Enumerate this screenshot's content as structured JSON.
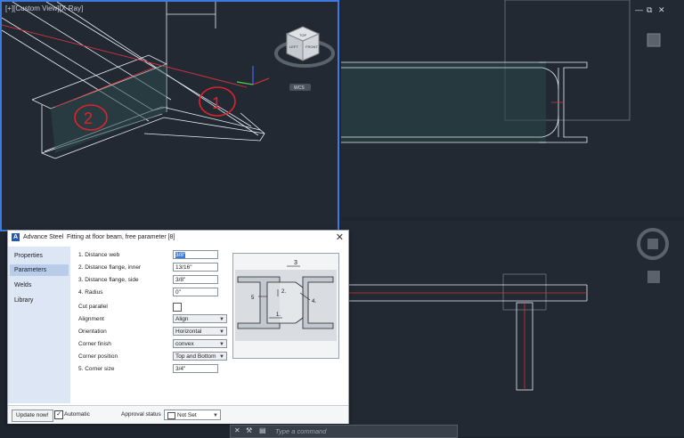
{
  "viewports": {
    "top_left_label": "[+][Custom View][X-Ray]",
    "top_left_elevation": "WCS"
  },
  "window_controls": {
    "minimize": "—",
    "restore": "⧉",
    "close": "✕"
  },
  "viewcube": {
    "top_face": "TOP",
    "left_face": "LEFT",
    "front_face": "FRONT"
  },
  "annotations": {
    "circled_one": "1",
    "circled_two": "2"
  },
  "dialog": {
    "app_name": "Advance Steel",
    "title": "Fitting at floor beam, free parameter [8]",
    "close_glyph": "✕",
    "sidebar": [
      {
        "label": "Properties"
      },
      {
        "label": "Parameters"
      },
      {
        "label": "Welds"
      },
      {
        "label": "Library"
      }
    ],
    "fields": {
      "distance_web": {
        "label": "1. Distance web",
        "value": "3/8\""
      },
      "distance_flange_inner": {
        "label": "2. Distance flange, inner",
        "value": "13/16\""
      },
      "distance_flange_side": {
        "label": "3. Distance flange, side",
        "value": "3/8\""
      },
      "radius": {
        "label": "4. Radius",
        "value": "0\""
      },
      "cut_parallel": {
        "label": "Cut parallel",
        "checked": false
      },
      "alignment": {
        "label": "Alignment",
        "value": "Align"
      },
      "orientation": {
        "label": "Orientation",
        "value": "Horizontal"
      },
      "corner_finish": {
        "label": "Corner finish",
        "value": "convex"
      },
      "corner_position": {
        "label": "Corner position",
        "value": "Top and Bottom"
      },
      "corner_size": {
        "label": "5. Corner size",
        "value": "3/4\""
      }
    },
    "preview_labels": {
      "d1": "1.",
      "d2": "2.",
      "d3": "3",
      "d4": "4.",
      "d5": "5"
    },
    "footer": {
      "update_button": "Update now!",
      "automatic_label": "Automatic",
      "automatic_checked": true,
      "approval_label": "Approval status",
      "approval_value": "Not Set"
    }
  },
  "command_line": {
    "placeholder": "Type a command"
  },
  "colors": {
    "viewport_bg": "#222933",
    "active_border": "#3d7be0",
    "beam_line": "#e8eef5",
    "axis_red": "#d6343a",
    "axis_green": "#4bd04b",
    "axis_blue": "#3a6ff0",
    "annotation_red": "#e0222a"
  }
}
